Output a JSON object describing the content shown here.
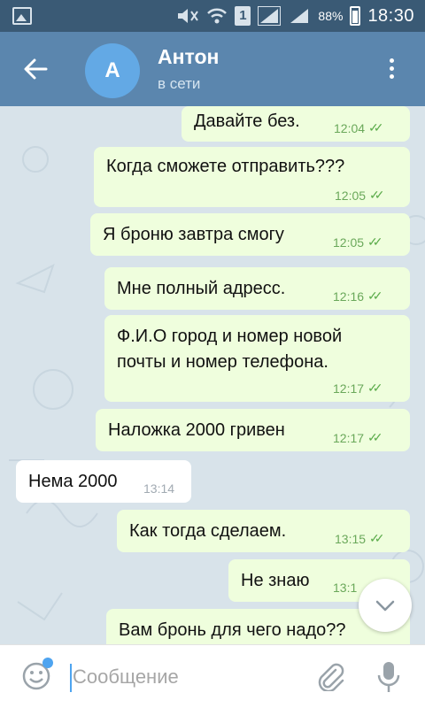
{
  "status_bar": {
    "sim": "1",
    "battery": "88%",
    "time": "18:30"
  },
  "header": {
    "avatar_letter": "А",
    "name": "Антон",
    "status": "в сети"
  },
  "messages": [
    {
      "direction": "out",
      "text": "Давайте без.",
      "time": "12:04",
      "read": true
    },
    {
      "direction": "out",
      "text": "Когда сможете отправить???",
      "time": "12:05",
      "read": true
    },
    {
      "direction": "out",
      "text": "Я броню завтра смогу",
      "time": "12:05",
      "read": true
    },
    {
      "direction": "out",
      "text": "Мне полный адресс.",
      "time": "12:16",
      "read": true
    },
    {
      "direction": "out",
      "text_line1": "Ф.И.О город и номер новой",
      "text_line2": "почты и номер телефона.",
      "time": "12:17",
      "read": true
    },
    {
      "direction": "out",
      "text": "Наложка 2000 гривен",
      "time": "12:17",
      "read": true
    },
    {
      "direction": "in",
      "text": "Нема 2000",
      "time": "13:14"
    },
    {
      "direction": "out",
      "text": "Как тогда сделаем.",
      "time": "13:15",
      "read": true
    },
    {
      "direction": "out",
      "text": "Не знаю",
      "time": "13:1",
      "read": true
    },
    {
      "direction": "out",
      "text": "Вам бронь для чего надо??"
    }
  ],
  "input": {
    "placeholder": "Сообщение",
    "value": ""
  },
  "colors": {
    "header": "#5b86ae",
    "status_bar": "#3a5a75",
    "outgoing_bubble": "#effedd",
    "incoming_bubble": "#ffffff",
    "chat_background": "#d8e3ea",
    "accent": "#4ea4f0"
  },
  "icons": [
    "gallery-icon",
    "mute-icon",
    "wifi-icon",
    "signal-icon",
    "battery-icon",
    "back-arrow-icon",
    "more-vert-icon",
    "read-check-icon",
    "chevron-down-icon",
    "emoji-icon",
    "attach-icon",
    "mic-icon"
  ]
}
